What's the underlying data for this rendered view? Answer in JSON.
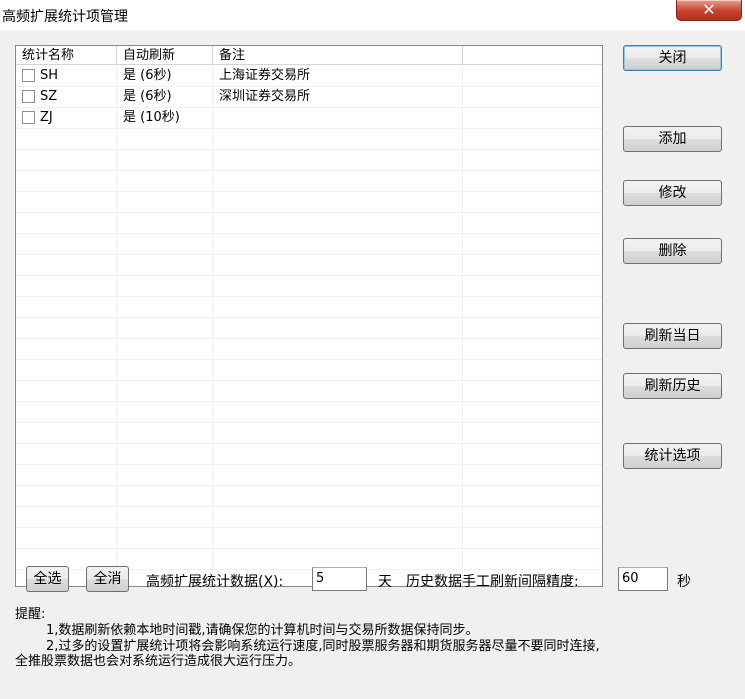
{
  "window": {
    "title": "高频扩展统计项管理",
    "close_glyph": "✕"
  },
  "list": {
    "columns": [
      "统计名称",
      "自动刷新",
      "备注",
      ""
    ],
    "rows": [
      {
        "name": "SH",
        "refresh": "是 (6秒)",
        "note": "上海证券交易所"
      },
      {
        "name": "SZ",
        "refresh": "是 (6秒)",
        "note": "深圳证券交易所"
      },
      {
        "name": "ZJ",
        "refresh": "是 (10秒)",
        "note": ""
      }
    ]
  },
  "buttons": {
    "close": "关闭",
    "add": "添加",
    "edit": "修改",
    "delete": "删除",
    "refresh_today": "刷新当日",
    "refresh_history": "刷新历史",
    "stat_options": "统计选项",
    "select_all": "全选",
    "deselect_all": "全消"
  },
  "controls": {
    "days_label": "高频扩展统计数据(X):",
    "days_value": "5",
    "days_unit": "天",
    "interval_label": "历史数据手工刷新间隔精度:",
    "interval_value": "60",
    "interval_unit": "秒"
  },
  "notes": {
    "heading": "提醒:",
    "line1": "1,数据刷新依赖本地时间戳,请确保您的计算机时间与交易所数据保持同步。",
    "line2": "2,过多的设置扩展统计项将会影响系统运行速度,同时股票服务器和期货服务器尽量不要同时连接,",
    "line3": "全推股票数据也会对系统运行造成很大运行压力。"
  }
}
